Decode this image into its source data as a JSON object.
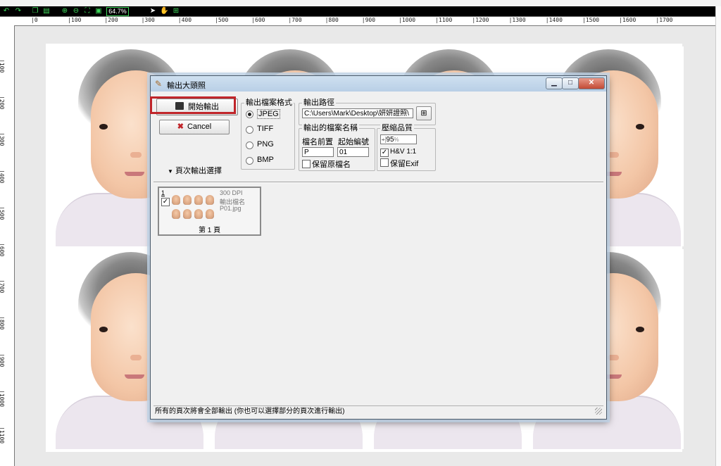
{
  "toolbar": {
    "zoom": "64.7%",
    "icons": [
      "undo-icon",
      "redo-icon",
      "copy-icon",
      "paste-icon",
      "zoom-in-icon",
      "zoom-out-icon",
      "fit-page-icon",
      "actual-size-icon",
      "select-arrow-icon",
      "hand-pan-icon",
      "add-icon"
    ]
  },
  "ruler": {
    "h_ticks": [
      "0",
      "100",
      "200",
      "300",
      "400",
      "500",
      "600",
      "700",
      "800",
      "900",
      "1000",
      "1100",
      "1200",
      "1300",
      "1400",
      "1500",
      "1600",
      "1700"
    ],
    "v_ticks": [
      "100",
      "200",
      "300",
      "400",
      "500",
      "600",
      "700",
      "800",
      "900",
      "1000",
      "1100"
    ]
  },
  "dialog": {
    "title": "輸出大頭照",
    "start_button": "開始輸出",
    "cancel_button": "Cancel",
    "page_options_label": "頁次輸出選擇",
    "format_group": {
      "label": "輸出檔案格式",
      "options": [
        "JPEG",
        "TIFF",
        "PNG",
        "BMP"
      ],
      "selected": "JPEG"
    },
    "path_group": {
      "label": "輸出路徑",
      "value": "C:\\Users\\Mark\\Desktop\\妍妍證照\\"
    },
    "filename_group": {
      "label": "輸出的檔案名稱",
      "prefix_label": "檔名前置",
      "prefix_value": "P",
      "start_label": "起始編號",
      "start_value": "01",
      "keep_original_label": "保留原檔名",
      "keep_original_checked": false
    },
    "quality_group": {
      "label": "壓縮品質",
      "quality_value": "95",
      "quality_suffix": "%",
      "hv_label": "H&V 1:1",
      "hv_checked": true,
      "exif_label": "保留Exif",
      "exif_checked": false
    },
    "page_card": {
      "index": "1",
      "checked": true,
      "dpi": "300 DPI",
      "filename_label": "輸出檔名",
      "filename": "P01.jpg",
      "page_label": "第 1 頁"
    },
    "status": "所有的頁次將會全部輸出 (你也可以選擇部分的頁次進行輸出)"
  },
  "colors": {
    "highlight": "#c0252a",
    "toolbar_bg": "#000000",
    "toolbar_icon": "#3dd65a"
  }
}
